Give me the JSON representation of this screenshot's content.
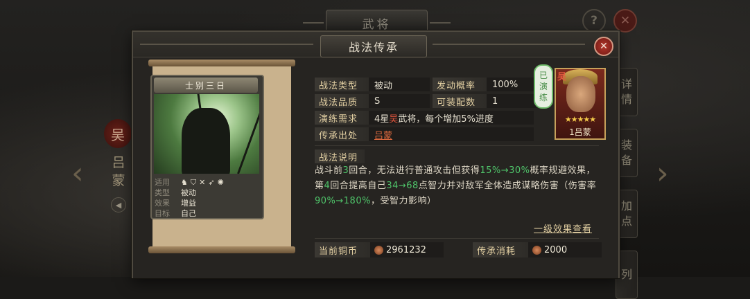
{
  "background": {
    "top_title": "武将",
    "help_icon": "?",
    "close_icon": "✕",
    "hero_faction": "吴",
    "hero_name_vertical": "吕蒙",
    "right_tabs": [
      "详情",
      "装备",
      "加点",
      "列"
    ]
  },
  "dialog": {
    "title": "战法传承",
    "close_icon": "✕"
  },
  "card": {
    "title": "士别三日",
    "rows": [
      {
        "label": "适用",
        "value": ""
      },
      {
        "label": "类型",
        "value": "被动"
      },
      {
        "label": "效果",
        "value": "增益"
      },
      {
        "label": "目标",
        "value": "自己"
      }
    ],
    "unit_icons": [
      "cavalry-icon",
      "shield-icon",
      "spear-icon",
      "bow-icon",
      "siege-icon"
    ]
  },
  "info": {
    "type_label": "战法类型",
    "type_value": "被动",
    "rate_label": "发动概率",
    "rate_value": "100%",
    "quality_label": "战法品质",
    "quality_value": "S",
    "equip_label": "可装配数",
    "equip_value": "1",
    "req_label": "演练需求",
    "req_value_prefix": "4星",
    "req_value_faction": "吴",
    "req_value_suffix": "武将，每个增加5%进度",
    "source_label": "传承出处",
    "source_value": "吕蒙",
    "desc_label": "战法说明",
    "desc_parts": [
      "战斗前",
      "3",
      "回合，无法进行普通攻击但获得",
      "15%→30%",
      "概率规避效果，第",
      "4",
      "回合提高自己",
      "34→68",
      "点智力并对敌军全体造成谋略伤害（伤害率",
      "90%→180%",
      "，受智力影响）"
    ],
    "learned_badge": "已演练",
    "more_link": "一级效果查看"
  },
  "portrait": {
    "faction": "吴",
    "stars": "★★★★★",
    "name": "1吕蒙"
  },
  "cost": {
    "copper_label": "当前铜币",
    "copper_value": "2961232",
    "inherit_label": "传承消耗",
    "inherit_value": "2000"
  },
  "colors": {
    "accent_label": "#e2cfa2",
    "faction_wu": "#e2553c",
    "green_value": "#4fc46a",
    "close_red": "#b3372c"
  }
}
